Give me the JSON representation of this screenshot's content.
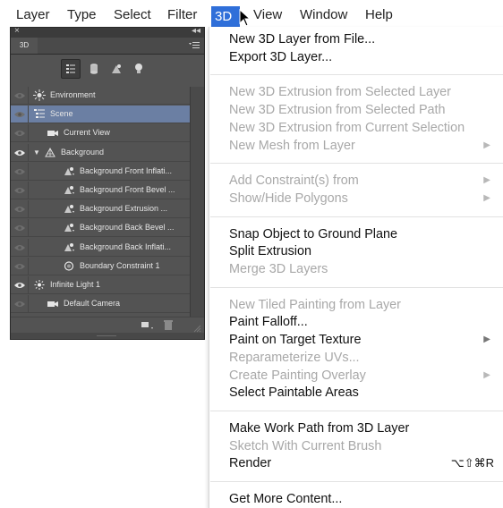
{
  "menubar": {
    "items": [
      "Layer",
      "Type",
      "Select",
      "Filter",
      "3D",
      "View",
      "Window",
      "Help"
    ],
    "active": "3D"
  },
  "panel": {
    "close_glyph": "×",
    "collapse_glyph": "◂◂",
    "tab_label": "3D",
    "layers": [
      {
        "label": "Environment",
        "icon": "environment-icon",
        "indent": 0,
        "selected": false,
        "eye_visible": false
      },
      {
        "label": "Scene",
        "icon": "scene-icon",
        "indent": 0,
        "selected": true,
        "eye_visible": false
      },
      {
        "label": "Current View",
        "icon": "camera-icon",
        "indent": 1,
        "selected": false,
        "eye_visible": false
      },
      {
        "label": "Background",
        "icon": "mesh-icon",
        "indent": 0,
        "selected": false,
        "eye_visible": true,
        "expanded": true
      },
      {
        "label": "Background Front Inflati...",
        "icon": "material-icon",
        "indent": 2,
        "selected": false,
        "eye_visible": false
      },
      {
        "label": "Background Front Bevel ...",
        "icon": "material-icon",
        "indent": 2,
        "selected": false,
        "eye_visible": false
      },
      {
        "label": "Background Extrusion ...",
        "icon": "material-icon",
        "indent": 2,
        "selected": false,
        "eye_visible": false
      },
      {
        "label": "Background Back Bevel ...",
        "icon": "material-icon",
        "indent": 2,
        "selected": false,
        "eye_visible": false
      },
      {
        "label": "Background Back Inflati...",
        "icon": "material-icon",
        "indent": 2,
        "selected": false,
        "eye_visible": false
      },
      {
        "label": "Boundary Constraint 1",
        "icon": "constraint-icon",
        "indent": 2,
        "selected": false,
        "eye_visible": false
      },
      {
        "label": "Infinite Light 1",
        "icon": "light-icon",
        "indent": 0,
        "selected": false,
        "eye_visible": true
      },
      {
        "label": "Default Camera",
        "icon": "camera-icon",
        "indent": 1,
        "selected": false,
        "eye_visible": false
      }
    ]
  },
  "dropdown": {
    "groups": [
      [
        {
          "label": "New 3D Layer from File...",
          "enabled": true
        },
        {
          "label": "Export 3D Layer...",
          "enabled": true
        }
      ],
      [
        {
          "label": "New 3D Extrusion from Selected Layer",
          "enabled": false
        },
        {
          "label": "New 3D Extrusion from Selected Path",
          "enabled": false
        },
        {
          "label": "New 3D Extrusion from Current Selection",
          "enabled": false
        },
        {
          "label": "New Mesh from Layer",
          "enabled": false,
          "submenu": true
        }
      ],
      [
        {
          "label": "Add Constraint(s) from",
          "enabled": false,
          "submenu": true
        },
        {
          "label": "Show/Hide Polygons",
          "enabled": false,
          "submenu": true
        }
      ],
      [
        {
          "label": "Snap Object to Ground Plane",
          "enabled": true
        },
        {
          "label": "Split Extrusion",
          "enabled": true
        },
        {
          "label": "Merge 3D Layers",
          "enabled": false
        }
      ],
      [
        {
          "label": "New Tiled Painting from Layer",
          "enabled": false
        },
        {
          "label": "Paint Falloff...",
          "enabled": true
        },
        {
          "label": "Paint on Target Texture",
          "enabled": true,
          "submenu": true
        },
        {
          "label": "Reparameterize UVs...",
          "enabled": false
        },
        {
          "label": "Create Painting Overlay",
          "enabled": false,
          "submenu": true
        },
        {
          "label": "Select Paintable Areas",
          "enabled": true
        }
      ],
      [
        {
          "label": "Make Work Path from 3D Layer",
          "enabled": true
        },
        {
          "label": "Sketch With Current Brush",
          "enabled": false
        },
        {
          "label": "Render",
          "enabled": true,
          "shortcut": "⌥⇧⌘R"
        }
      ],
      [
        {
          "label": "Get More Content...",
          "enabled": true
        }
      ]
    ]
  },
  "colors": {
    "menu_highlight": "#2f6fd9",
    "panel_bg": "#535353",
    "row_selected": "#6b7fa3",
    "disabled_text": "#a8a8a8"
  }
}
